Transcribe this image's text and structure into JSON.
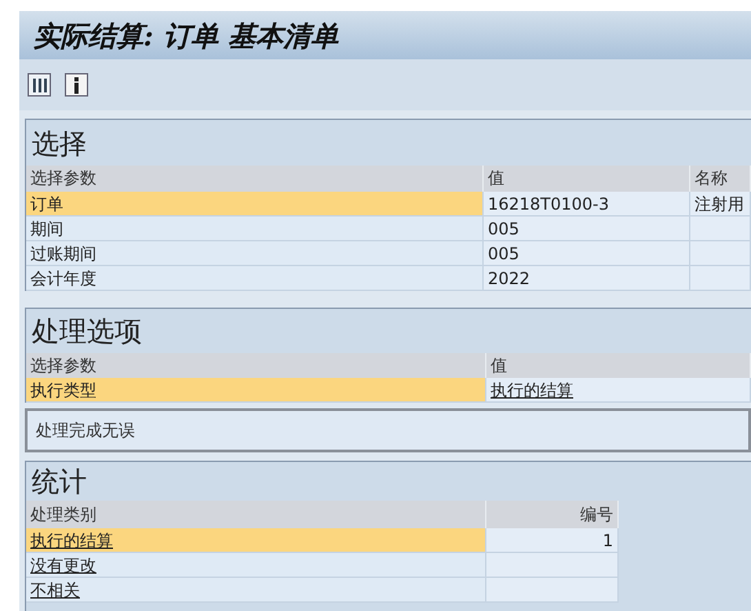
{
  "window": {
    "title": "实际结算: 订单 基本清单"
  },
  "selection": {
    "title": "选择",
    "columns": [
      "选择参数",
      "值",
      "名称"
    ],
    "rows": [
      {
        "param": "订单",
        "value": "16218T0100-3",
        "name": "注射用",
        "selected": true
      },
      {
        "param": "期间",
        "value": "005",
        "name": "",
        "selected": false
      },
      {
        "param": "过账期间",
        "value": "005",
        "name": "",
        "selected": false
      },
      {
        "param": "会计年度",
        "value": "2022",
        "name": "",
        "selected": false
      }
    ]
  },
  "processing": {
    "title": "处理选项",
    "columns": [
      "选择参数",
      "值"
    ],
    "rows": [
      {
        "param": "执行类型",
        "value": "执行的结算",
        "selected": true
      }
    ]
  },
  "message": "处理完成无误",
  "statistics": {
    "title": "统计",
    "columns": [
      "处理类别",
      "编号"
    ],
    "rows": [
      {
        "category": "执行的结算",
        "count": "1",
        "selected": true
      },
      {
        "category": "没有更改",
        "count": "",
        "selected": false
      },
      {
        "category": "不相关",
        "count": "",
        "selected": false
      }
    ]
  }
}
